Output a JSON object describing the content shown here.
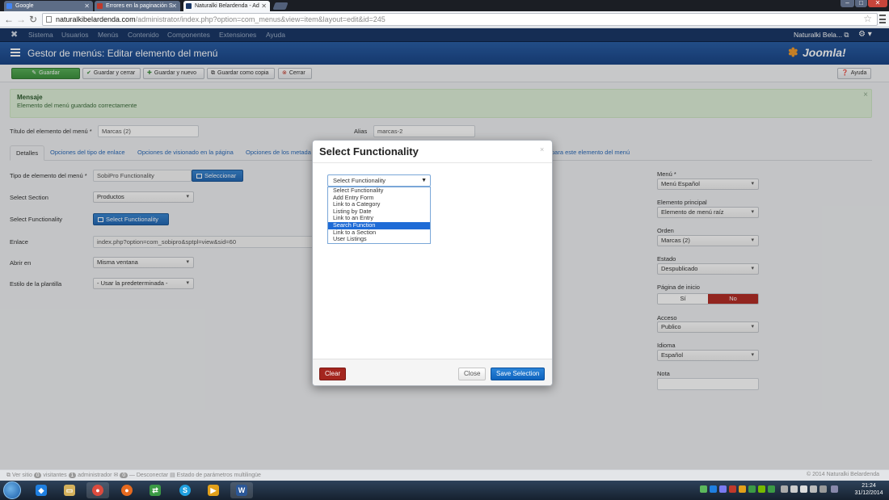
{
  "browser": {
    "tabs": [
      {
        "title": "Google",
        "color": "#4285f4"
      },
      {
        "title": "Errores en la paginación S",
        "color": "#c0392b"
      },
      {
        "title": "Naturalki Belardenda - Ad",
        "color": "#1a3867"
      }
    ],
    "url_domain": "naturalkibelardenda.com",
    "url_path": "/administrator/index.php?option=com_menus&view=item&layout=edit&id=245"
  },
  "joomla": {
    "nav": [
      "Sistema",
      "Usuarios",
      "Menús",
      "Contenido",
      "Componentes",
      "Extensiones",
      "Ayuda"
    ],
    "user": "Naturalki Bela...",
    "page_title": "Gestor de menús: Editar elemento del menú",
    "brand": "Joomla!",
    "toolbar": {
      "save": "Guardar",
      "save_close": "Guardar y cerrar",
      "save_new": "Guardar y nuevo",
      "save_copy": "Guardar como copia",
      "close": "Cerrar",
      "help": "Ayuda"
    },
    "message": {
      "title": "Mensaje",
      "body": "Elemento del menú guardado correctamente"
    },
    "form": {
      "title_label": "Título del elemento del menú *",
      "title_value": "Marcas (2)",
      "alias_label": "Alias",
      "alias_value": "marcas-2",
      "tabs": [
        "Detalles",
        "Opciones del tipo de enlace",
        "Opciones de visionado en la página",
        "Opciones de los metada",
        "para este elemento del menú"
      ],
      "type_label": "Tipo de elemento del menú *",
      "type_value": "SobiPro Functionality",
      "select_button": "Seleccionar",
      "section_label": "Select Section",
      "section_value": "Productos",
      "function_label": "Select Functionality",
      "function_button": "Select Functionality",
      "link_label": "Enlace",
      "link_value": "index.php?option=com_sobipro&sptpl=view&sid=60",
      "open_label": "Abrir en",
      "open_value": "Misma ventana",
      "style_label": "Estilo de la plantilla",
      "style_value": "- Usar la predeterminada -"
    },
    "side": {
      "menu_label": "Menú *",
      "menu_value": "Menú Español",
      "parent_label": "Elemento principal",
      "parent_value": "Elemento de menú raíz",
      "order_label": "Orden",
      "order_value": "Marcas (2)",
      "state_label": "Estado",
      "state_value": "Despublicado",
      "home_label": "Página de inicio",
      "home_yes": "Sí",
      "home_no": "No",
      "access_label": "Acceso",
      "access_value": "Publico",
      "lang_label": "Idioma",
      "lang_value": "Español",
      "note_label": "Nota",
      "note_value": ""
    },
    "footer": {
      "view_site": "Ver sitio",
      "visitors_count": "0",
      "visitors": "visitantes",
      "admins_count": "1",
      "admins": "administrador",
      "messages_count": "0",
      "logout": "Desconectar",
      "multilang": "Estado de parámetros multilingüe",
      "copyright": "© 2014 Naturalki Belardenda"
    }
  },
  "modal": {
    "title": "Select Functionality",
    "dropdown_value": "Select Functionality",
    "options": [
      "Select Functionality",
      "Add Entry Form",
      "Link to a Category",
      "Listing by Date",
      "Link to an Entry",
      "Search Function",
      "Link to a Section",
      "User Listings"
    ],
    "highlighted_option": "Search Function",
    "clear": "Clear",
    "close": "Close",
    "save": "Save Selection"
  },
  "taskbar": {
    "time": "21:24",
    "date": "31/12/2014"
  }
}
